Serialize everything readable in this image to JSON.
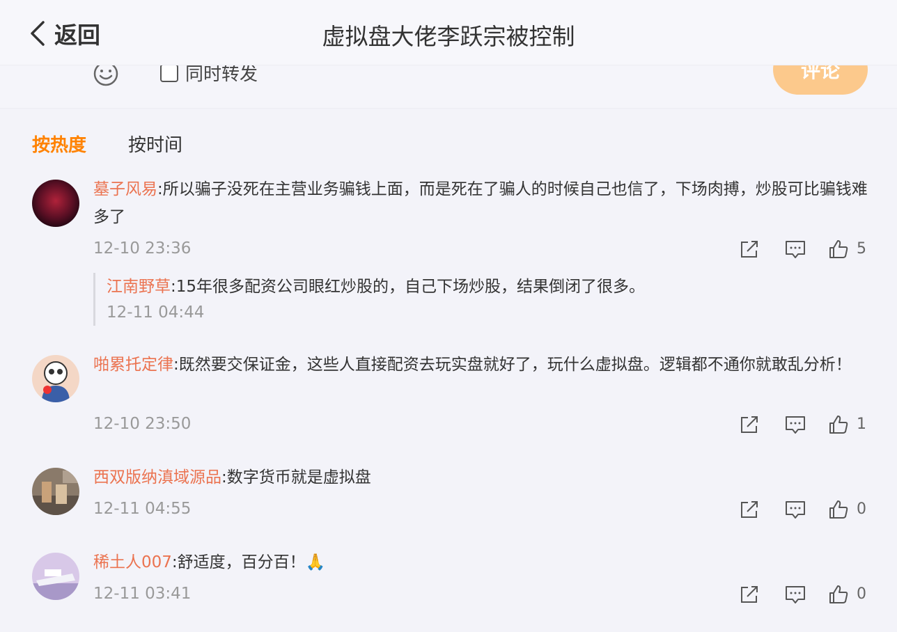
{
  "header": {
    "back_label": "返回",
    "title": "虚拟盘大佬李跃宗被控制"
  },
  "composer": {
    "repost_label": "同时转发",
    "comment_button": "评论"
  },
  "sort": {
    "hot": "按热度",
    "time": "按时间"
  },
  "colors": {
    "accent": "#ff8200",
    "username": "#eb7350",
    "comment_btn": "#fcc98c"
  },
  "comments": [
    {
      "user": "墓子风易",
      "text": "所以骗子没死在主营业务骗钱上面，而是死在了骗人的时候自己也信了，下场肉搏，炒股可比骗钱难多了",
      "time": "12-10 23:36",
      "likes": "5",
      "reply": {
        "user": "江南野草",
        "text": "15年很多配资公司眼红炒股的，自己下场炒股，结果倒闭了很多。",
        "time": "12-11 04:44"
      }
    },
    {
      "user": "啪累托定律",
      "text": "既然要交保证金，这些人直接配资去玩实盘就好了，玩什么虚拟盘。逻辑都不通你就敢乱分析！",
      "time": "12-10 23:50",
      "likes": "1"
    },
    {
      "user": "西双版纳滇域源品",
      "text": "数字货币就是虚拟盘",
      "time": "12-11 04:55",
      "likes": "0"
    },
    {
      "user": "稀土人007",
      "text": "舒适度，百分百！🙏",
      "time": "12-11 03:41",
      "likes": "0"
    }
  ],
  "icons": [
    "back-chevron-icon",
    "smile-icon",
    "share-icon",
    "comment-icon",
    "like-icon",
    "avatar"
  ]
}
